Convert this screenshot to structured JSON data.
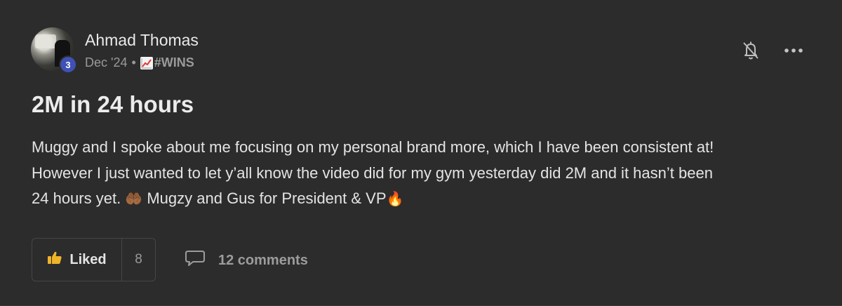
{
  "post": {
    "author": "Ahmad Thomas",
    "level": "3",
    "date": "Dec '24",
    "separator": "•",
    "category": "#WINS",
    "title": "2M in 24 hours",
    "body_line1": "Muggy and I spoke about me focusing on my personal brand more, which I have been consistent at!",
    "body_line2": "However I just wanted to let y’all know the video did for my gym yesterday did 2M and it hasn’t been",
    "body_line3_a": "24 hours yet.",
    "body_emoji_hands": "🤲🏾",
    "body_line3_b": "Mugzy and Gus for President & VP",
    "body_emoji_fire": "🔥"
  },
  "actions": {
    "like_label": "Liked",
    "like_count": "8",
    "comments_label": "12 comments"
  },
  "icons": {
    "bell": "bell-off-icon",
    "more": "more-horizontal-icon",
    "like": "thumbs-up-icon",
    "comment": "comment-icon",
    "category": "chart-increasing-emoji"
  },
  "colors": {
    "background": "#2c2c2c",
    "level_badge": "#3f51b5",
    "like_icon": "#f0b429"
  }
}
